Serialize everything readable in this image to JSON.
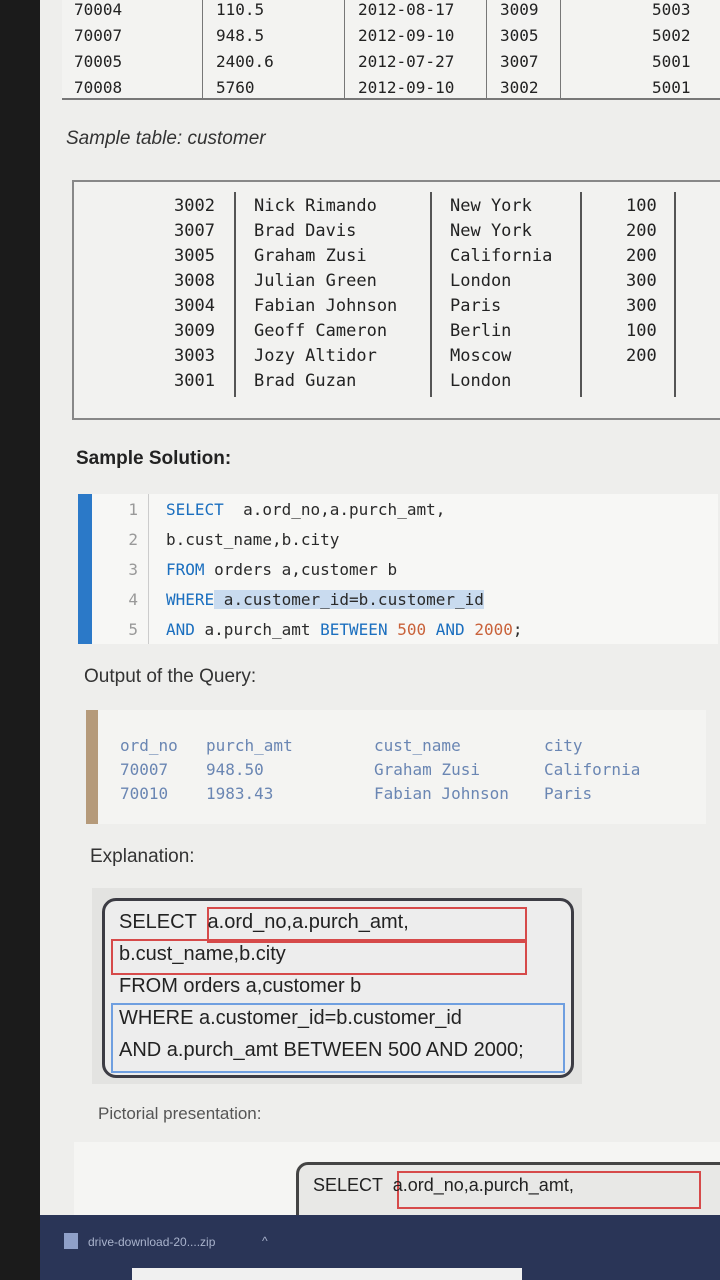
{
  "orders_partial": {
    "rows": [
      [
        "70004",
        "110.5",
        "2012-08-17",
        "3009",
        "5003"
      ],
      [
        "70007",
        "948.5",
        "2012-09-10",
        "3005",
        "5002"
      ],
      [
        "70005",
        "2400.6",
        "2012-07-27",
        "3007",
        "5001"
      ],
      [
        "70008",
        "5760",
        "2012-09-10",
        "3002",
        "5001"
      ]
    ]
  },
  "caption": "Sample table: customer",
  "customer_table": {
    "rows": [
      [
        "3002",
        "Nick Rimando",
        "New York",
        "100"
      ],
      [
        "3007",
        "Brad Davis",
        "New York",
        "200"
      ],
      [
        "3005",
        "Graham Zusi",
        "California",
        "200"
      ],
      [
        "3008",
        "Julian Green",
        "London",
        "300"
      ],
      [
        "3004",
        "Fabian Johnson",
        "Paris",
        "300"
      ],
      [
        "3009",
        "Geoff Cameron",
        "Berlin",
        "100"
      ],
      [
        "3003",
        "Jozy Altidor",
        "Moscow",
        "200"
      ],
      [
        "3001",
        "Brad Guzan",
        "London",
        ""
      ]
    ]
  },
  "solution": {
    "heading": "Sample Solution:",
    "lines": [
      {
        "n": "1",
        "kw": "SELECT",
        "rest": "  a.ord_no,a.purch_amt,"
      },
      {
        "n": "2",
        "kw": "",
        "rest": "b.cust_name,b.city"
      },
      {
        "n": "3",
        "kw": "FROM",
        "rest": " orders a,customer b"
      },
      {
        "n": "4",
        "kw": "WHERE",
        "rest": " a.customer_id=b.customer_id"
      },
      {
        "n": "5",
        "kw": "AND",
        "rest": " a.purch_amt ",
        "kw2": "BETWEEN",
        "v1": "500",
        "kw3": "AND",
        "v2": "2000",
        "end": ";"
      }
    ]
  },
  "output": {
    "heading": "Output of the Query:",
    "columns": [
      "ord_no",
      "purch_amt",
      "cust_name",
      "city"
    ],
    "rows": [
      [
        "70007",
        "948.50",
        "Graham Zusi",
        "California"
      ],
      [
        "70010",
        "1983.43",
        "Fabian Johnson",
        "Paris"
      ]
    ]
  },
  "explanation": {
    "heading": "Explanation:",
    "lines": [
      "SELECT  a.ord_no,a.purch_amt,",
      "b.cust_name,b.city",
      "FROM orders a,customer b",
      "WHERE a.customer_id=b.customer_id",
      "AND a.purch_amt BETWEEN 500 AND 2000;"
    ]
  },
  "pictorial": {
    "heading": "Pictorial presentation:",
    "line": "SELECT  a.ord_no,a.purch_amt,"
  },
  "download_bar": {
    "filename": "drive-download-20....zip",
    "chevron": "^"
  },
  "colors": {
    "code_accent": "#2b79c8",
    "output_accent": "#b59a7a",
    "highlight_red": "#d64a4a",
    "highlight_blue": "#6f9fe0",
    "download_bar": "#2a3557"
  }
}
